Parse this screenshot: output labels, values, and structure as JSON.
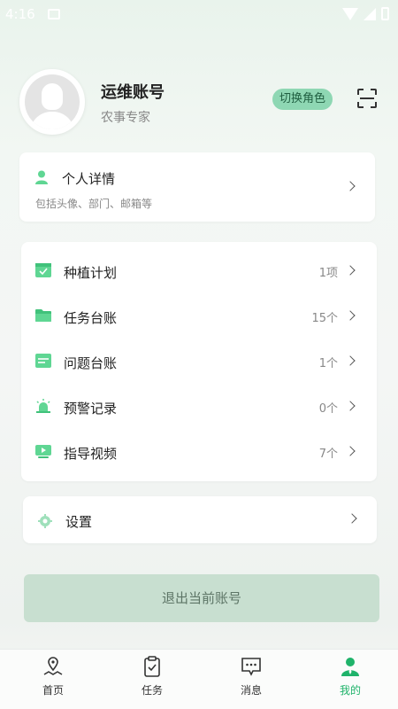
{
  "status_bar": {
    "time": "4:16"
  },
  "profile": {
    "name": "运维账号",
    "role": "农事专家",
    "switch_role_label": "切换角色"
  },
  "detail_card": {
    "title": "个人详情",
    "subtitle": "包括头像、部门、邮箱等"
  },
  "list": {
    "items": [
      {
        "label": "种植计划",
        "count": "1项",
        "icon": "calendar-check-icon"
      },
      {
        "label": "任务台账",
        "count": "15个",
        "icon": "folder-icon"
      },
      {
        "label": "问题台账",
        "count": "1个",
        "icon": "list-card-icon"
      },
      {
        "label": "预警记录",
        "count": "0个",
        "icon": "alarm-light-icon"
      },
      {
        "label": "指导视频",
        "count": "7个",
        "icon": "video-play-icon"
      }
    ]
  },
  "settings": {
    "label": "设置",
    "icon": "gear-icon"
  },
  "logout": {
    "label": "退出当前账号"
  },
  "tabbar": {
    "tabs": [
      {
        "label": "首页",
        "icon": "map-pin-icon"
      },
      {
        "label": "任务",
        "icon": "clipboard-check-icon"
      },
      {
        "label": "消息",
        "icon": "chat-bubble-icon"
      },
      {
        "label": "我的",
        "icon": "user-icon"
      }
    ],
    "active": "我的"
  },
  "colors": {
    "accent": "#1fb36a",
    "badge_bg": "#8ed7b3",
    "icon_green": "#5fd693",
    "logout_bg": "#c8dfd0"
  }
}
